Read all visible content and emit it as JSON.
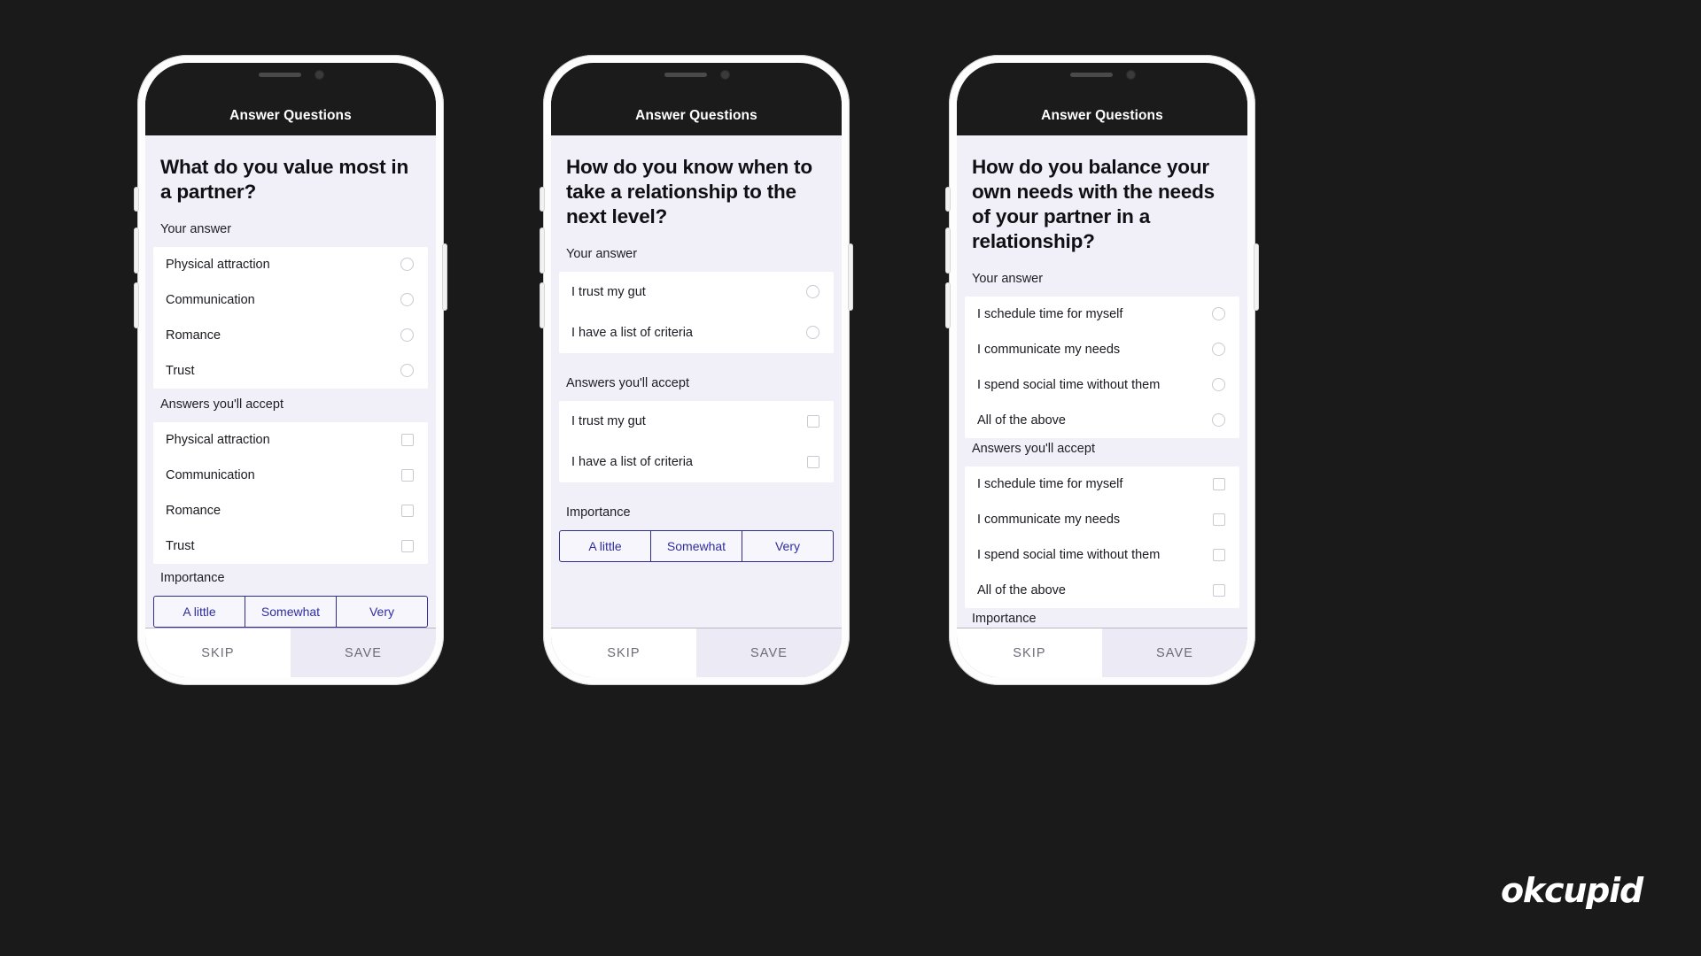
{
  "app": {
    "title": "Answer Questions",
    "brand": "okcupid",
    "accent_blue": "#2e2e9e",
    "screen_bg": "#f1f0f9",
    "card_bg": "#ffffff",
    "bar_bg": "#1b1b1b",
    "save_bg": "#eceaf4"
  },
  "labels": {
    "your_answer": "Your answer",
    "answers_youll_accept": "Answers you'll accept",
    "importance": "Importance",
    "skip": "SKIP",
    "save": "SAVE"
  },
  "importance_options": [
    "A little",
    "Somewhat",
    "Very"
  ],
  "phones": [
    {
      "id": "phone-1",
      "title": "Answer Questions",
      "question": "What do you value most in a partner?",
      "your_answer_options": [
        "Physical attraction",
        "Communication",
        "Romance",
        "Trust"
      ],
      "accept_options": [
        "Physical attraction",
        "Communication",
        "Romance",
        "Trust"
      ],
      "importance_label": "Importance",
      "importance_visible": false,
      "importance_selected": null
    },
    {
      "id": "phone-2",
      "title": "Answer Questions",
      "question": "How do you know when to take a relationship to the next level?",
      "your_answer_options": [
        "I trust my gut",
        "I have a list of criteria"
      ],
      "accept_options": [
        "I trust my gut",
        "I have a list of criteria"
      ],
      "importance_label": "Importance",
      "importance_visible": true,
      "importance_selected": null
    },
    {
      "id": "phone-3",
      "title": "Answer Questions",
      "question": "How do you balance your own needs with the needs of your partner in a relationship?",
      "your_answer_options": [
        "I schedule time for myself",
        "I communicate my needs",
        "I spend social time without them",
        "All of the above"
      ],
      "accept_options": [
        "I schedule time for myself",
        "I communicate my needs",
        "I spend social time without them",
        "All of the above"
      ],
      "importance_label": "Importance",
      "importance_visible": false,
      "importance_selected": null
    }
  ]
}
